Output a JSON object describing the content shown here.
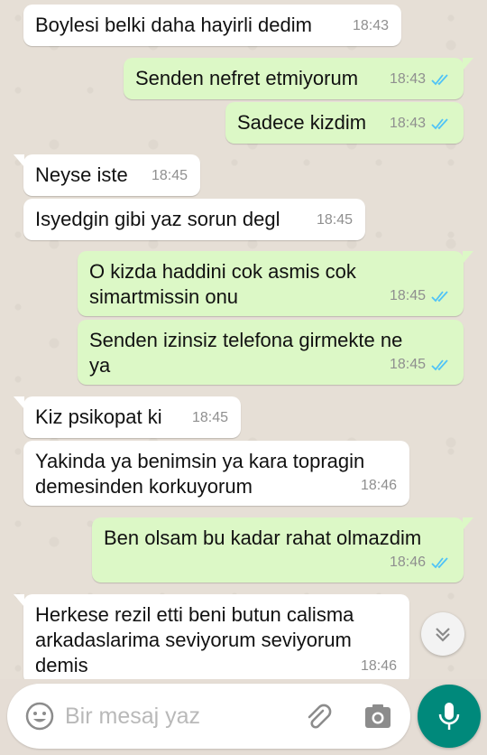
{
  "messages": [
    {
      "dir": "in",
      "text": "Boylesi belki daha hayirli dedim",
      "time": "18:43"
    },
    {
      "dir": "out",
      "text": "Senden nefret etmiyorum",
      "time": "18:43"
    },
    {
      "dir": "out",
      "text": "Sadece kizdim",
      "time": "18:43"
    },
    {
      "dir": "in",
      "text": "Neyse iste",
      "time": "18:45"
    },
    {
      "dir": "in",
      "text": "Isyedgin gibi yaz sorun degl",
      "time": "18:45"
    },
    {
      "dir": "out",
      "line1": "O kizda haddini cok asmis cok",
      "line2": "simartmissin onu",
      "time": "18:45"
    },
    {
      "dir": "out",
      "line1": "Senden izinsiz telefona girmekte ne",
      "line2": "ya",
      "time": "18:45"
    },
    {
      "dir": "in",
      "text": "Kiz psikopat ki",
      "time": "18:45"
    },
    {
      "dir": "in",
      "line1": "Yakinda ya benimsin ya kara topragin",
      "line2": "demesinden korkuyorum",
      "time": "18:46"
    },
    {
      "dir": "out",
      "text": "Ben olsam bu kadar rahat olmazdim",
      "time": "18:46"
    },
    {
      "dir": "in",
      "line1": "Herkese rezil etti beni butun calisma",
      "line2": "arkadaslarima seviyorum seviyorum",
      "line3": "demis",
      "time": "18:46"
    }
  ],
  "input": {
    "placeholder": "Bir mesaj yaz"
  },
  "colors": {
    "incoming": "#ffffff",
    "outgoing": "#dcf8c6",
    "accent": "#00897b",
    "read_ticks": "#4fc3f7"
  },
  "icons": {
    "emoji": "emoji-icon",
    "attach": "paperclip-icon",
    "camera": "camera-icon",
    "mic": "mic-icon",
    "scroll": "double-chevron-down-icon"
  }
}
